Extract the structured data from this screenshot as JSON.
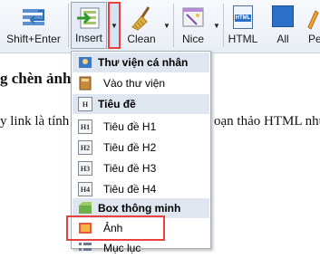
{
  "toolbar": {
    "buttons": [
      {
        "id": "shift-enter",
        "label": "Shift+Enter"
      },
      {
        "id": "insert",
        "label": "Insert"
      },
      {
        "id": "clean",
        "label": "Clean"
      },
      {
        "id": "nice",
        "label": "Nice"
      },
      {
        "id": "html",
        "label": "HTML"
      },
      {
        "id": "all",
        "label": "All"
      },
      {
        "id": "partial",
        "label": "Pe"
      }
    ],
    "html_icon_text": "HTML"
  },
  "document": {
    "heading_fragment": "g chèn ảnh",
    "line_left": "y link là tính",
    "line_right": "oạn thảo HTML như"
  },
  "menu": {
    "items": [
      {
        "type": "header",
        "label": "Thư viện cá nhân"
      },
      {
        "type": "item",
        "label": "Vào thư viện"
      },
      {
        "type": "header",
        "label": "Tiêu đề"
      },
      {
        "type": "item",
        "label": "Tiêu đề H1",
        "icon_text": "H1"
      },
      {
        "type": "item",
        "label": "Tiêu đề H2",
        "icon_text": "H2"
      },
      {
        "type": "item",
        "label": "Tiêu đề H3",
        "icon_text": "H3"
      },
      {
        "type": "item",
        "label": "Tiêu đề H4",
        "icon_text": "H4"
      },
      {
        "type": "header",
        "label": "Box thông minh"
      },
      {
        "type": "item",
        "label": "Ảnh",
        "highlighted": true
      },
      {
        "type": "item",
        "label": "Mục lục"
      }
    ]
  },
  "colors": {
    "highlight_border": "#e8413f",
    "accent_blue": "#2b6fc9"
  }
}
